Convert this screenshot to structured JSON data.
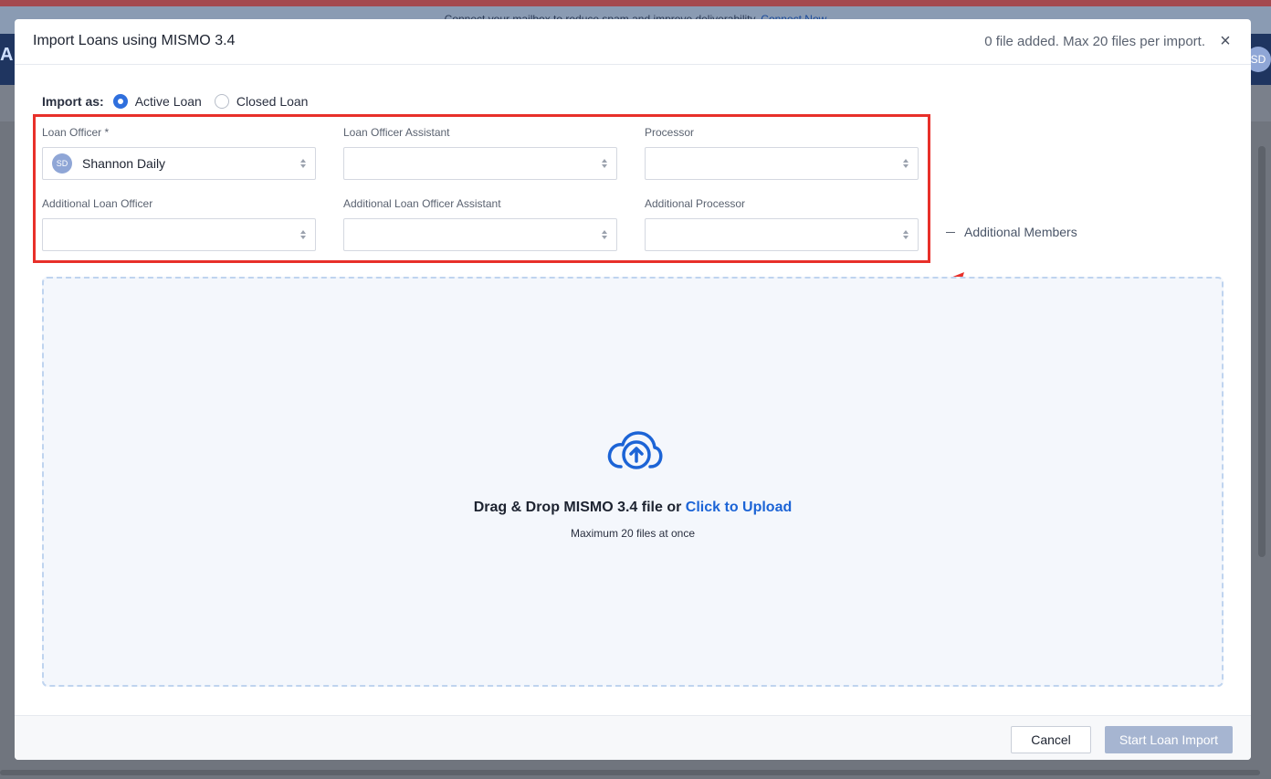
{
  "background": {
    "banner_text": "Connect your mailbox to reduce spam and improve deliverability.",
    "banner_link": "Connect Now",
    "nav_logo": "A",
    "nav_avatar": "SD"
  },
  "modal": {
    "title": "Import Loans using MISMO 3.4",
    "file_count": "0 file added. Max 20 files per import.",
    "close_glyph": "×"
  },
  "import_as": {
    "label": "Import as:",
    "options": [
      {
        "label": "Active Loan",
        "selected": true
      },
      {
        "label": "Closed Loan",
        "selected": false
      }
    ]
  },
  "fields": {
    "loan_officer": {
      "label": "Loan Officer *",
      "value": "Shannon Daily",
      "avatar_initials": "SD"
    },
    "loan_officer_assistant": {
      "label": "Loan Officer Assistant",
      "value": ""
    },
    "processor": {
      "label": "Processor",
      "value": ""
    },
    "additional_loan_officer": {
      "label": "Additional Loan Officer",
      "value": ""
    },
    "additional_loan_officer_assistant": {
      "label": "Additional Loan Officer Assistant",
      "value": ""
    },
    "additional_processor": {
      "label": "Additional Processor",
      "value": ""
    }
  },
  "additional_members": {
    "label": "Additional Members"
  },
  "dropzone": {
    "text": "Drag & Drop MISMO 3.4 file or",
    "link": "Click to Upload",
    "subtext": "Maximum 20 files at once",
    "icon": "cloud-upload-icon"
  },
  "footer": {
    "cancel": "Cancel",
    "start": "Start Loan Import"
  },
  "colors": {
    "accent": "#2f6fdd",
    "link": "#1c64d6",
    "highlight": "#e8302a",
    "disabled_button": "#a6b5d1"
  }
}
